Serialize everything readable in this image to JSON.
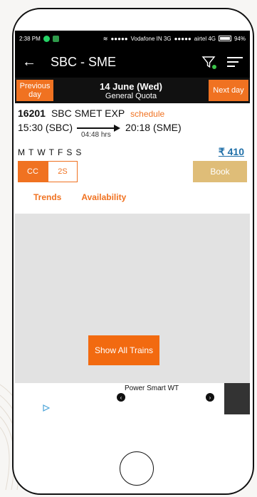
{
  "status_bar": {
    "time": "2:38 PM",
    "carrier1": "Vodafone IN 3G",
    "carrier2": "airtel 4G",
    "battery": "94%"
  },
  "app_bar": {
    "back_icon": "back-arrow-icon",
    "title": "SBC - SME",
    "filter_icon": "filter-icon",
    "sort_icon": "sort-icon"
  },
  "date_bar": {
    "prev_label": "Previous day",
    "date": "14 June (Wed)",
    "quota": "General Quota",
    "next_label": "Next day"
  },
  "train": {
    "number": "16201",
    "name": "SBC SMET EXP",
    "schedule_label": "schedule",
    "departure": "15:30 (SBC)",
    "arrival": "20:18 (SME)",
    "duration": "04:48 hrs",
    "days": [
      "M",
      "T",
      "W",
      "T",
      "F",
      "S",
      "S"
    ],
    "fare": "₹ 410",
    "classes": [
      {
        "label": "CC",
        "selected": true
      },
      {
        "label": "2S",
        "selected": false
      }
    ],
    "book_label": "Book"
  },
  "tabs": {
    "trends": "Trends",
    "availability": "Availability"
  },
  "main": {
    "show_all_label": "Show All Trains"
  },
  "ad": {
    "text": "Power Smart WT"
  },
  "colors": {
    "accent": "#f07221",
    "fare_link": "#1f6fa8",
    "book": "#dfbd78",
    "app_bar": "#000000"
  }
}
